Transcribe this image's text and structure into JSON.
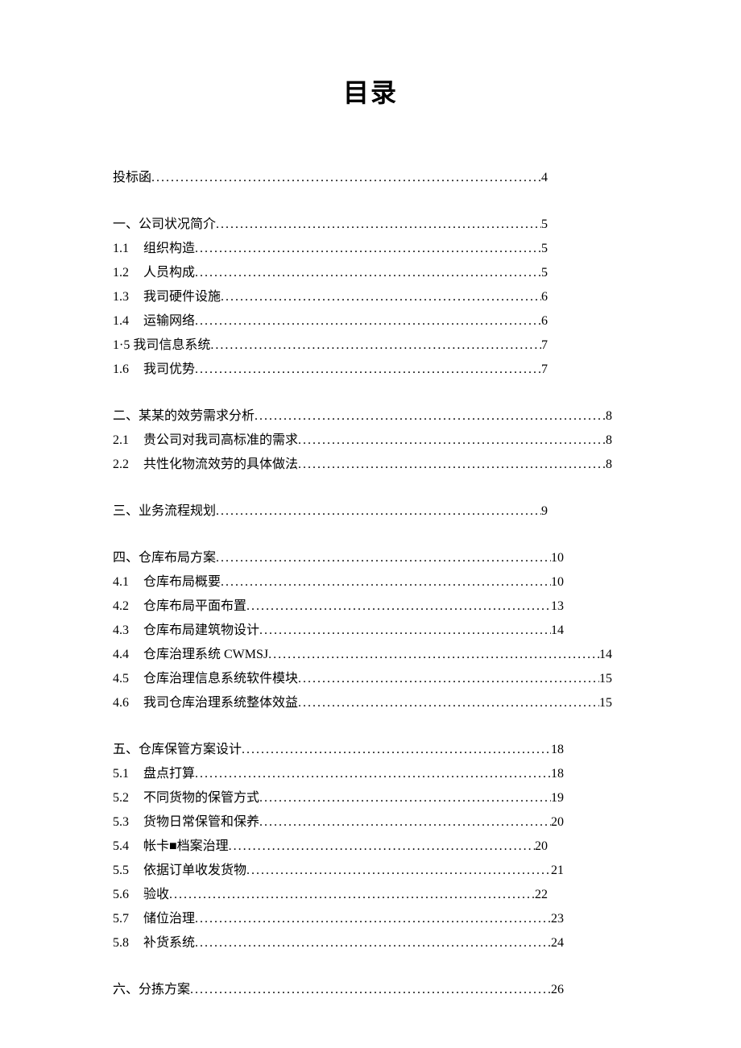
{
  "title": "目录",
  "entries": [
    {
      "group": 0,
      "number": "",
      "label": "投标函",
      "page": "4",
      "widthClass": "w3"
    },
    {
      "group": 1,
      "number": "",
      "label": "一、公司状况简介",
      "page": "5",
      "widthClass": "w3"
    },
    {
      "group": 1,
      "number": "1.1",
      "label": "组织构造",
      "page": "5",
      "widthClass": "w3"
    },
    {
      "group": 1,
      "number": "1.2",
      "label": "人员构成",
      "page": "5",
      "widthClass": "w3"
    },
    {
      "group": 1,
      "number": "1.3",
      "label": "我司硬件设施",
      "page": "6",
      "widthClass": "w3"
    },
    {
      "group": 1,
      "number": "1.4",
      "label": "运输网络",
      "page": "6",
      "widthClass": "w3"
    },
    {
      "group": 1,
      "number": "",
      "label": "1·5 我司信息系统",
      "page": "7",
      "widthClass": "w3"
    },
    {
      "group": 1,
      "number": "1.6",
      "label": "我司优势",
      "page": "7",
      "widthClass": "w3"
    },
    {
      "group": 2,
      "number": "",
      "label": "二、某某的效劳需求分析",
      "page": "8",
      "widthClass": "w2"
    },
    {
      "group": 2,
      "number": "2.1",
      "label": "贵公司对我司高标准的需求",
      "page": "8",
      "widthClass": "w2"
    },
    {
      "group": 2,
      "number": "2.2",
      "label": "共性化物流效劳的具体做法",
      "page": "8",
      "widthClass": "w2"
    },
    {
      "group": 3,
      "number": "",
      "label": "三、业务流程规划",
      "page": "9",
      "widthClass": "w3"
    },
    {
      "group": 4,
      "number": "",
      "label": "四、仓库布局方案",
      "page": "10",
      "widthClass": "w1"
    },
    {
      "group": 4,
      "number": "4.1",
      "label": "仓库布局概要",
      "page": "10",
      "widthClass": "w1"
    },
    {
      "group": 4,
      "number": "4.2",
      "label": "仓库布局平面布置",
      "page": "13",
      "widthClass": "w1"
    },
    {
      "group": 4,
      "number": "4.3",
      "label": "仓库布局建筑物设计",
      "page": "14",
      "widthClass": "w1"
    },
    {
      "group": 4,
      "number": "4.4",
      "label": "仓库治理系统 CWMSJ",
      "page": "14",
      "widthClass": "w2"
    },
    {
      "group": 4,
      "number": "4.5",
      "label": "仓库治理信息系统软件模块",
      "page": "15",
      "widthClass": "w2"
    },
    {
      "group": 4,
      "number": "4.6",
      "label": "我司仓库治理系统整体效益",
      "page": "15",
      "widthClass": "w2"
    },
    {
      "group": 5,
      "number": "",
      "label": "五、仓库保管方案设计",
      "page": "18",
      "widthClass": "w1"
    },
    {
      "group": 5,
      "number": "5.1",
      "label": "盘点打算",
      "page": "18",
      "widthClass": "w1"
    },
    {
      "group": 5,
      "number": "5.2",
      "label": "不同货物的保管方式",
      "page": "19",
      "widthClass": "w1"
    },
    {
      "group": 5,
      "number": "5.3",
      "label": "货物日常保管和保养",
      "page": "20",
      "widthClass": "w1"
    },
    {
      "group": 5,
      "number": "5.4",
      "label": "帐卡■档案治理",
      "page": "20",
      "widthClass": "w3"
    },
    {
      "group": 5,
      "number": "5.5",
      "label": "依据订单收发货物",
      "page": "21",
      "widthClass": "w1"
    },
    {
      "group": 5,
      "number": "5.6",
      "label": "验收",
      "page": "22",
      "widthClass": "w3"
    },
    {
      "group": 5,
      "number": "5.7",
      "label": "储位治理",
      "page": "23",
      "widthClass": "w1"
    },
    {
      "group": 5,
      "number": "5.8",
      "label": "补货系统",
      "page": "24",
      "widthClass": "w1"
    },
    {
      "group": 6,
      "number": "",
      "label": "六、分拣方案",
      "page": "26",
      "widthClass": "w1"
    }
  ]
}
